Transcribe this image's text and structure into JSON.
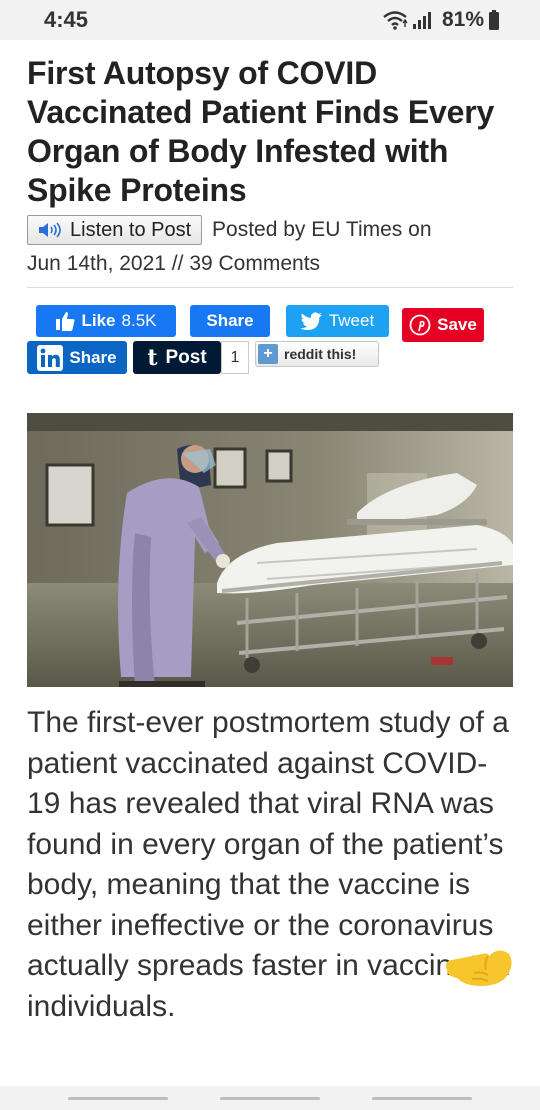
{
  "status": {
    "time": "4:45",
    "battery": "81%"
  },
  "article": {
    "title": "First Autopsy of COVID Vaccinated Patient Finds Every Organ of Body Infested with Spike Proteins",
    "listen_label": "Listen to Post",
    "posted_by_prefix": "Posted by",
    "author": "EU Times",
    "posted_on": "on",
    "date": "Jun 14th, 2021",
    "separator": "//",
    "comments": "39 Comments",
    "body": "The first-ever postmortem study of a patient vaccinated against COVID-19 has revealed that viral RNA was found in every organ of the patient’s body, meaning that the vaccine is either ineffective or the coronavirus actually spreads faster in vaccinated individuals."
  },
  "share": {
    "fb_like_label": "Like",
    "fb_like_count": "8.5K",
    "fb_share_label": "Share",
    "tweet_label": "Tweet",
    "pinterest_label": "Save",
    "linkedin_label": "Share",
    "tumblr_label": "Post",
    "tumblr_count": "1",
    "reddit_label": "reddit this!"
  },
  "icons": {
    "wifi": "wifi-icon",
    "signal": "signal-icon",
    "battery": "battery-icon",
    "speaker": "speaker-icon",
    "thumbs_up": "thumbs-up-icon",
    "twitter": "twitter-bird-icon",
    "pinterest": "pinterest-icon",
    "linkedin": "linkedin-icon",
    "tumblr": "tumblr-icon",
    "pointing_hand": "pointing-hand-emoji"
  },
  "colors": {
    "facebook": "#1877f2",
    "twitter": "#1da1f2",
    "pinterest": "#e60023",
    "linkedin": "#0a66c2",
    "tumblr": "#001935"
  }
}
